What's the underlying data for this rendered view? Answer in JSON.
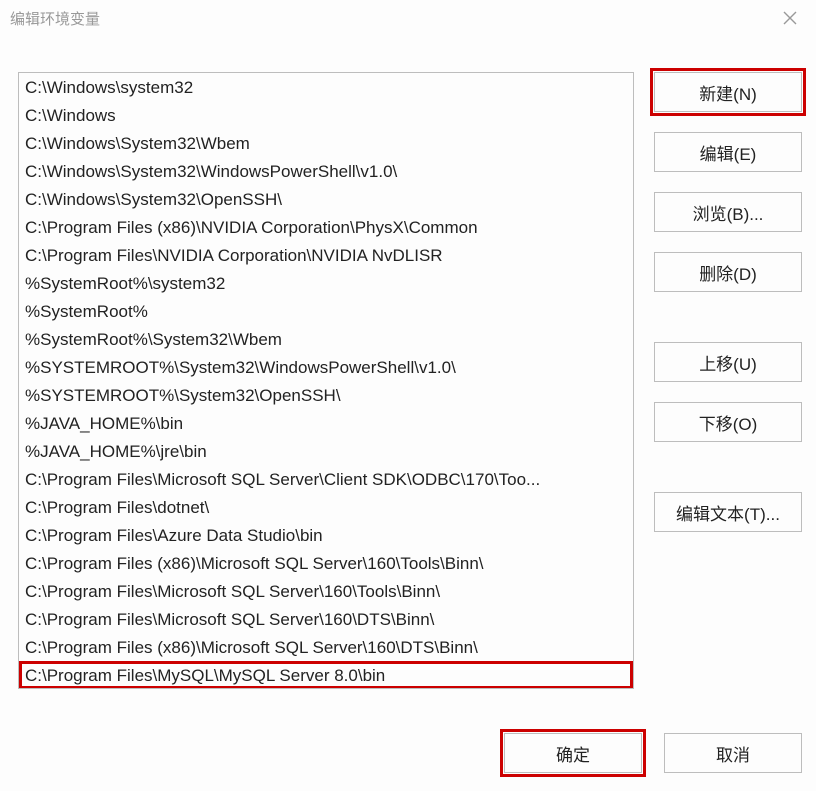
{
  "title": "编辑环境变量",
  "paths": [
    "C:\\Windows\\system32",
    "C:\\Windows",
    "C:\\Windows\\System32\\Wbem",
    "C:\\Windows\\System32\\WindowsPowerShell\\v1.0\\",
    "C:\\Windows\\System32\\OpenSSH\\",
    "C:\\Program Files (x86)\\NVIDIA Corporation\\PhysX\\Common",
    "C:\\Program Files\\NVIDIA Corporation\\NVIDIA NvDLISR",
    "%SystemRoot%\\system32",
    "%SystemRoot%",
    "%SystemRoot%\\System32\\Wbem",
    "%SYSTEMROOT%\\System32\\WindowsPowerShell\\v1.0\\",
    "%SYSTEMROOT%\\System32\\OpenSSH\\",
    "%JAVA_HOME%\\bin",
    "%JAVA_HOME%\\jre\\bin",
    "C:\\Program Files\\Microsoft SQL Server\\Client SDK\\ODBC\\170\\Too...",
    "C:\\Program Files\\dotnet\\",
    "C:\\Program Files\\Azure Data Studio\\bin",
    "C:\\Program Files (x86)\\Microsoft SQL Server\\160\\Tools\\Binn\\",
    "C:\\Program Files\\Microsoft SQL Server\\160\\Tools\\Binn\\",
    "C:\\Program Files\\Microsoft SQL Server\\160\\DTS\\Binn\\",
    "C:\\Program Files (x86)\\Microsoft SQL Server\\160\\DTS\\Binn\\",
    "C:\\Program Files\\MySQL\\MySQL Server 8.0\\bin"
  ],
  "highlighted_path_index": 21,
  "buttons": {
    "new": "新建(N)",
    "edit": "编辑(E)",
    "browse": "浏览(B)...",
    "delete": "删除(D)",
    "moveup": "上移(U)",
    "movedown": "下移(O)",
    "edittext": "编辑文本(T)...",
    "ok": "确定",
    "cancel": "取消"
  }
}
